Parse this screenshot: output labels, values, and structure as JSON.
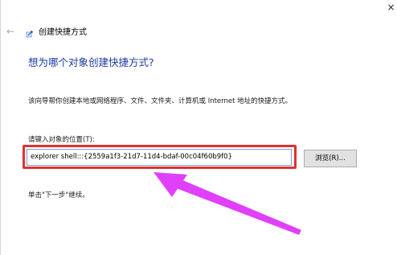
{
  "window": {
    "close_glyph": "×",
    "back_glyph": "←"
  },
  "wizard": {
    "title": "创建快捷方式",
    "icon": "shortcut-wizard-icon"
  },
  "main": {
    "heading": "想为哪个对象创建快捷方式?",
    "description": "该向导帮你创建本地或网络程序、文件、文件夹、计算机或 Internet 地址的快捷方式。",
    "field_label": "请键入对象的位置(T):",
    "location_value": "explorer shell:::{2559a1f3-21d7-11d4-bdaf-00c04f60b9f0}",
    "browse_label": "浏览(R)...",
    "hint": "单击\"下一步\"继续。"
  },
  "annotations": {
    "highlight_color": "#e03131",
    "arrow_color": "#e040fb"
  }
}
